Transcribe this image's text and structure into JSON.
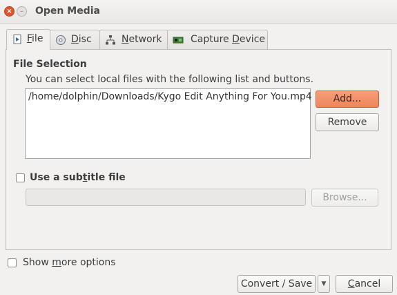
{
  "window": {
    "title": "Open Media",
    "close_glyph": "×",
    "minimize_glyph": "–"
  },
  "tabs": [
    {
      "pre": "",
      "acc": "F",
      "post": "ile",
      "icon": "file-media-icon",
      "active": true
    },
    {
      "pre": "",
      "acc": "D",
      "post": "isc",
      "icon": "disc-icon",
      "active": false
    },
    {
      "pre": "",
      "acc": "N",
      "post": "etwork",
      "icon": "network-icon",
      "active": false
    },
    {
      "pre": "Capture ",
      "acc": "D",
      "post": "evice",
      "icon": "capture-card-icon",
      "active": false
    }
  ],
  "file_selection": {
    "title": "File Selection",
    "hint": "You can select local files with the following list and buttons.",
    "files": [
      "/home/dolphin/Downloads/Kygo Edit Anything For You.mp4"
    ],
    "add_label": "Add...",
    "remove_label": "Remove"
  },
  "subtitle": {
    "label_pre": "Use a sub",
    "label_acc": "t",
    "label_post": "itle file",
    "checked": false,
    "path_value": "",
    "browse_label": "Browse..."
  },
  "options": {
    "label_pre": "Show ",
    "label_acc": "m",
    "label_post": "ore options",
    "checked": false
  },
  "footer": {
    "convert_label": "Convert / Save",
    "dropdown_glyph": "▼",
    "cancel_pre": "",
    "cancel_acc": "C",
    "cancel_post": "ancel"
  },
  "colors": {
    "accent": "#ef8a5f",
    "close": "#e0552f",
    "background": "#f2f1f0"
  }
}
